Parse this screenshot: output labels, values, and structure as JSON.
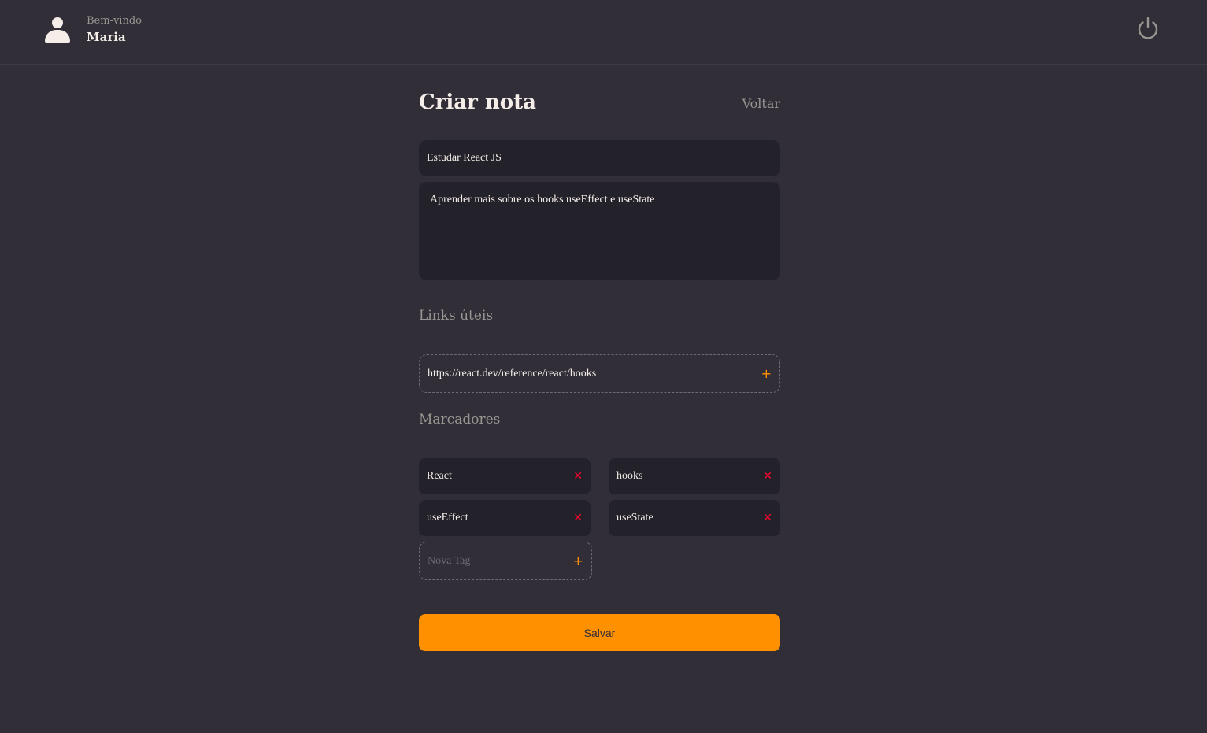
{
  "header": {
    "welcome": "Bem-vindo",
    "username": "Maria",
    "avatar_icon": "user-icon",
    "logout_icon": "power-icon"
  },
  "page": {
    "title": "Criar nota",
    "back_label": "Voltar"
  },
  "form": {
    "title_value": "Estudar React JS",
    "description_value": "Aprender mais sobre os hooks useEffect e useState"
  },
  "links": {
    "section_title": "Links úteis",
    "items": [
      "https://react.dev/reference/react/hooks"
    ],
    "add_icon": "plus-icon"
  },
  "tags": {
    "section_title": "Marcadores",
    "items": [
      "React",
      "hooks",
      "useEffect",
      "useState"
    ],
    "remove_icon": "close-icon",
    "new_placeholder": "Nova Tag",
    "add_icon": "plus-icon"
  },
  "actions": {
    "save_label": "Salvar"
  },
  "colors": {
    "background": "#312e38",
    "input_bg": "#232129",
    "accent": "#ff9000",
    "danger": "#ff002e",
    "muted": "#999591"
  }
}
